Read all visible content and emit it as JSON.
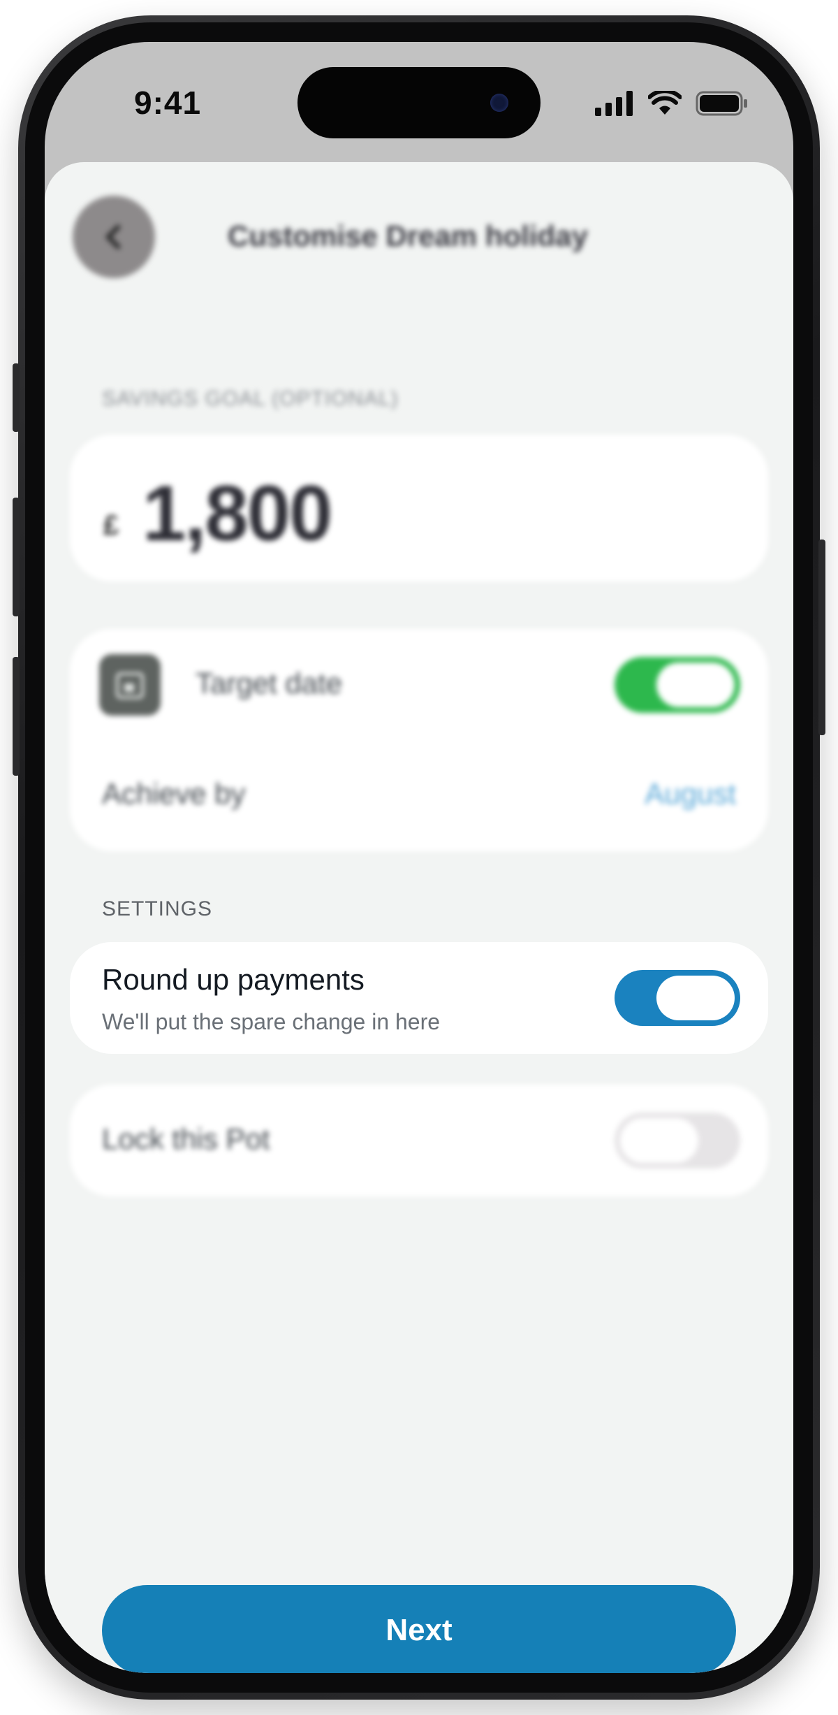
{
  "status_bar": {
    "time": "9:41",
    "icons": [
      "signal-icon",
      "wifi-icon",
      "battery-icon"
    ]
  },
  "header": {
    "back_icon": "chevron-left-icon",
    "title": "Customise Dream holiday"
  },
  "savings_goal": {
    "label": "SAVINGS GOAL (OPTIONAL)",
    "currency": "£",
    "amount": "1,800"
  },
  "target_date": {
    "icon": "calendar-icon",
    "label": "Target date",
    "enabled": true,
    "achieve_label": "Achieve by",
    "achieve_value": "August"
  },
  "settings": {
    "label": "SETTINGS",
    "round_up": {
      "title": "Round up payments",
      "subtitle": "We'll put the spare change in here",
      "enabled": true
    },
    "lock_pot": {
      "title": "Lock this Pot",
      "enabled": false
    }
  },
  "footer": {
    "next_label": "Next"
  },
  "colors": {
    "accent": "#1580b7",
    "toggle_green": "#2db84d",
    "toggle_blue": "#1a82bf",
    "link": "#5aa8d8",
    "sheet_bg": "#f2f4f3"
  }
}
